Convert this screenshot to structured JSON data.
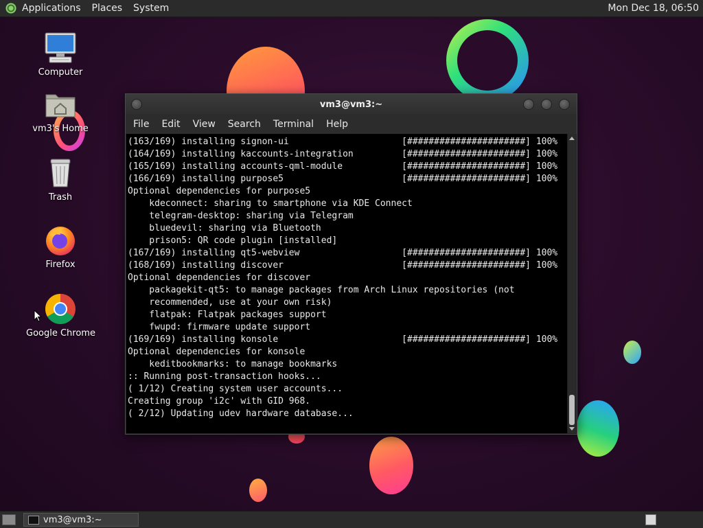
{
  "top_panel": {
    "menus": [
      "Applications",
      "Places",
      "System"
    ],
    "clock": "Mon Dec 18, 06:50"
  },
  "desktop": {
    "icons": [
      {
        "label": "Computer",
        "icon": "computer-icon"
      },
      {
        "label": "vm3's Home",
        "icon": "home-folder-icon"
      },
      {
        "label": "Trash",
        "icon": "trash-icon"
      },
      {
        "label": "Firefox",
        "icon": "firefox-icon"
      },
      {
        "label": "Google Chrome",
        "icon": "chrome-icon"
      }
    ]
  },
  "window": {
    "title": "vm3@vm3:~",
    "menus": [
      "File",
      "Edit",
      "View",
      "Search",
      "Terminal",
      "Help"
    ],
    "lines": [
      "(163/169) installing signon-ui                     [######################] 100%",
      "(164/169) installing kaccounts-integration         [######################] 100%",
      "(165/169) installing accounts-qml-module           [######################] 100%",
      "(166/169) installing purpose5                      [######################] 100%",
      "Optional dependencies for purpose5",
      "    kdeconnect: sharing to smartphone via KDE Connect",
      "    telegram-desktop: sharing via Telegram",
      "    bluedevil: sharing via Bluetooth",
      "    prison5: QR code plugin [installed]",
      "(167/169) installing qt5-webview                   [######################] 100%",
      "(168/169) installing discover                      [######################] 100%",
      "Optional dependencies for discover",
      "    packagekit-qt5: to manage packages from Arch Linux repositories (not",
      "    recommended, use at your own risk)",
      "    flatpak: Flatpak packages support",
      "    fwupd: firmware update support",
      "(169/169) installing konsole                       [######################] 100%",
      "Optional dependencies for konsole",
      "    keditbookmarks: to manage bookmarks",
      ":: Running post-transaction hooks...",
      "( 1/12) Creating system user accounts...",
      "Creating group 'i2c' with GID 968.",
      "( 2/12) Updating udev hardware database..."
    ]
  },
  "taskbar": {
    "task_label": "vm3@vm3:~"
  }
}
